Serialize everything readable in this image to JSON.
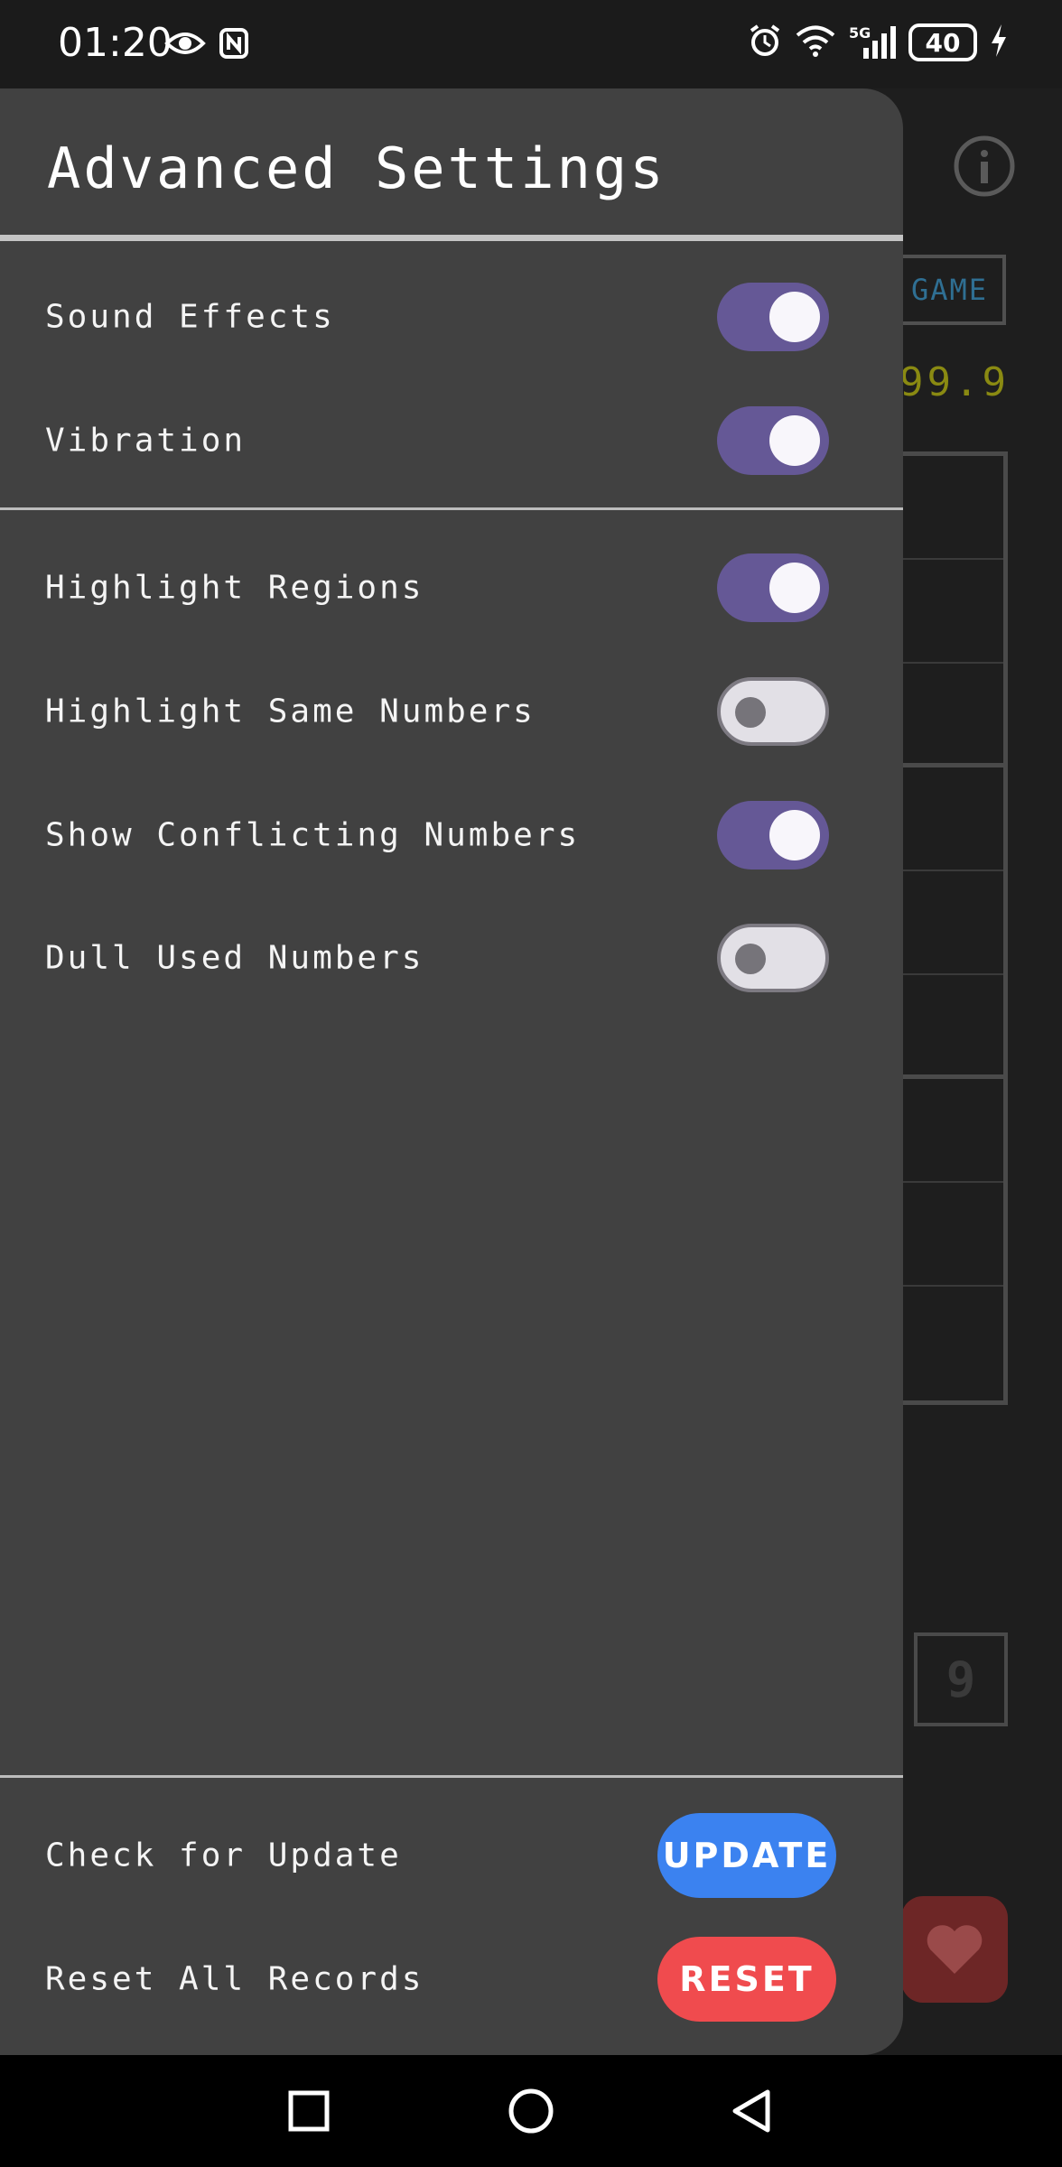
{
  "status_bar": {
    "time": "01:20",
    "network": "5G",
    "battery": "40",
    "icons": [
      "eye-icon",
      "nfc-icon",
      "alarm-icon",
      "wifi-icon",
      "signal-icon",
      "charging-icon"
    ]
  },
  "background_app": {
    "new_game_label": "GAME",
    "timer_text": "99.9",
    "keypad_number": "9"
  },
  "drawer": {
    "title": "Advanced Settings",
    "group1": [
      {
        "label": "Sound Effects",
        "on": true
      },
      {
        "label": "Vibration",
        "on": true
      }
    ],
    "group2": [
      {
        "label": "Highlight Regions",
        "on": true
      },
      {
        "label": "Highlight Same Numbers",
        "on": false
      },
      {
        "label": "Show Conflicting Numbers",
        "on": true
      },
      {
        "label": "Dull Used Numbers",
        "on": false
      }
    ],
    "actions": [
      {
        "label": "Check for Update",
        "button": "UPDATE"
      },
      {
        "label": "Reset All Records",
        "button": "RESET"
      }
    ]
  },
  "colors": {
    "toggle_on": "#655896",
    "update_button": "#3b82f0",
    "reset_button": "#f04b4e"
  }
}
